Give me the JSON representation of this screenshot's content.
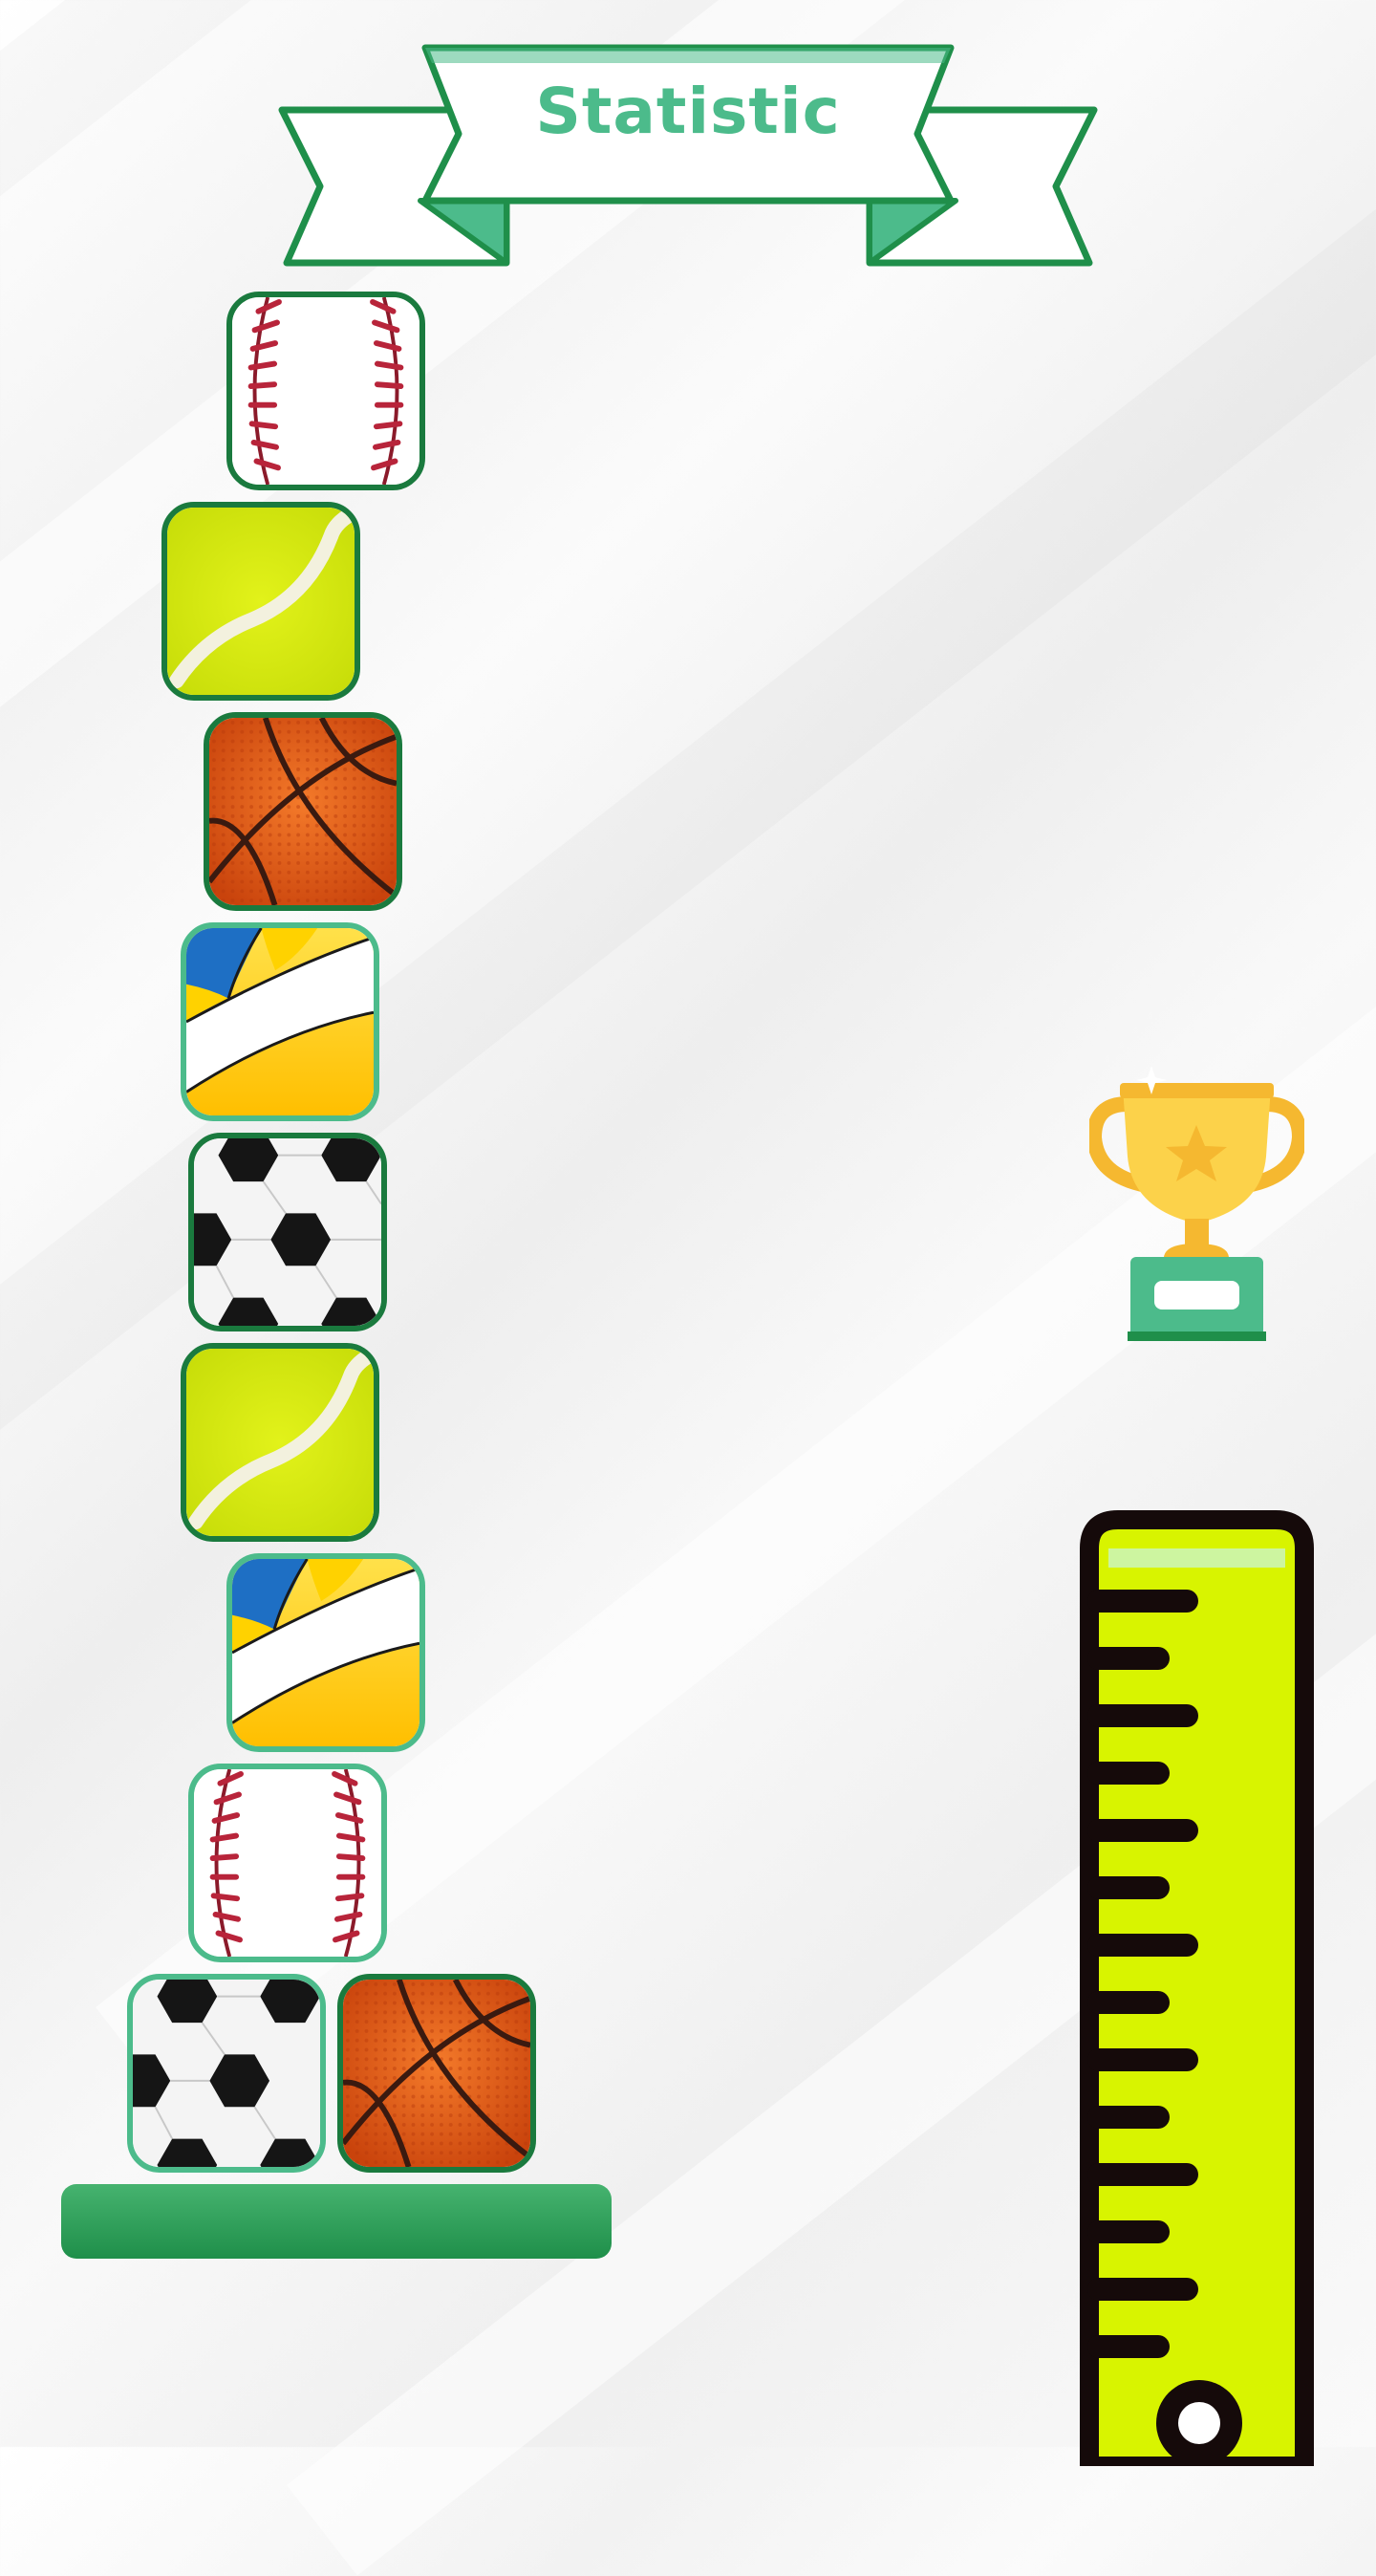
{
  "screen": {
    "title": "Statistic"
  },
  "colors": {
    "accent": "#4cbb8b",
    "accent_dark": "#1f8f4a",
    "tile_border_light": "#4cbb8b",
    "tile_border_dark": "#1a7a3e",
    "ruler_fill": "#d8f400",
    "ruler_outline": "#150a0a"
  },
  "stack": {
    "tiles": [
      {
        "ball": "baseball"
      },
      {
        "ball": "tennis"
      },
      {
        "ball": "basketball"
      },
      {
        "ball": "volleyball"
      },
      {
        "ball": "soccer"
      },
      {
        "ball": "tennis"
      },
      {
        "ball": "volleyball"
      },
      {
        "ball": "baseball"
      },
      {
        "ball": "soccer"
      },
      {
        "ball": "basketball"
      }
    ]
  },
  "icons": {
    "trophy": "trophy-icon",
    "ruler": "height-ruler-icon"
  }
}
